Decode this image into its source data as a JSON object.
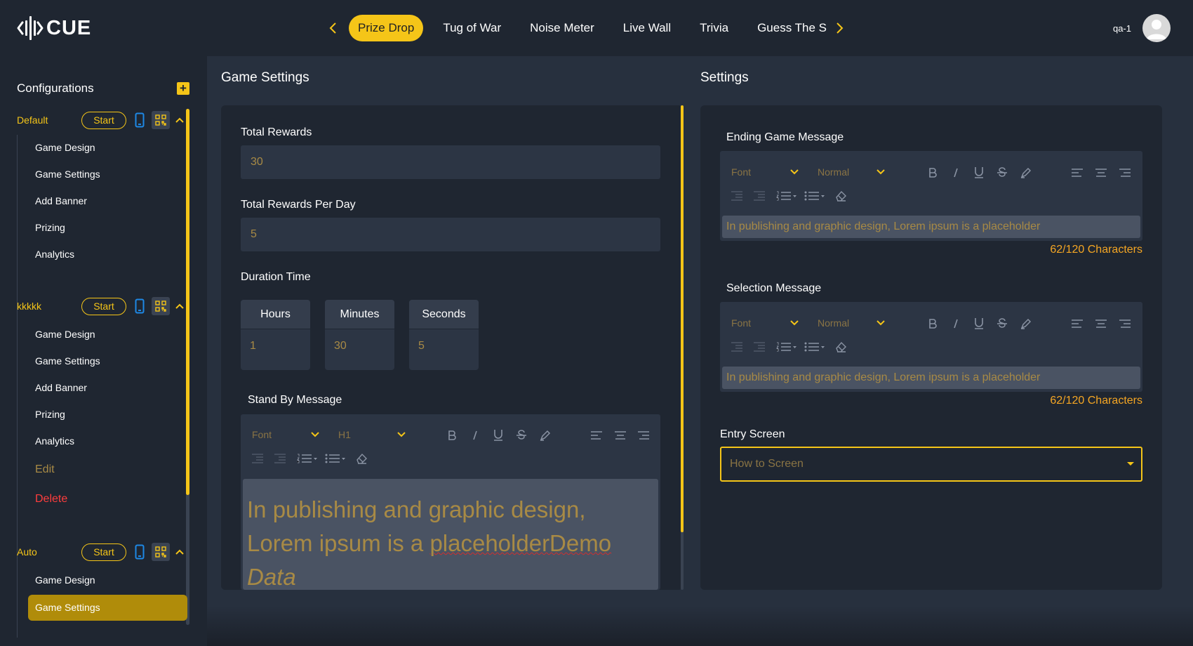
{
  "brand": {
    "name": "CUE"
  },
  "nav": {
    "tabs": [
      {
        "label": "Prize Drop",
        "active": true
      },
      {
        "label": "Tug of War"
      },
      {
        "label": "Noise Meter"
      },
      {
        "label": "Live Wall"
      },
      {
        "label": "Trivia"
      },
      {
        "label": "Guess The Sc"
      }
    ]
  },
  "user": {
    "name": "qa-1"
  },
  "sidebar": {
    "title": "Configurations",
    "groups": [
      {
        "name": "Default",
        "start_label": "Start",
        "items": [
          "Game Design",
          "Game Settings",
          "Add Banner",
          "Prizing",
          "Analytics"
        ]
      },
      {
        "name": "kkkkk",
        "start_label": "Start",
        "items": [
          "Game Design",
          "Game Settings",
          "Add Banner",
          "Prizing",
          "Analytics"
        ],
        "edit_label": "Edit",
        "delete_label": "Delete"
      },
      {
        "name": "Auto",
        "start_label": "Start",
        "items": [
          "Game Design",
          "Game Settings"
        ],
        "active_item": "Game Settings"
      }
    ]
  },
  "game_settings": {
    "title": "Game Settings",
    "total_rewards": {
      "label": "Total Rewards",
      "value": "30"
    },
    "total_rewards_per_day": {
      "label": "Total Rewards Per Day",
      "value": "5"
    },
    "duration": {
      "label": "Duration Time",
      "hours": {
        "label": "Hours",
        "value": "1"
      },
      "minutes": {
        "label": "Minutes",
        "value": "30"
      },
      "seconds": {
        "label": "Seconds",
        "value": "5"
      }
    },
    "standby": {
      "label": "Stand By Message",
      "font": "Font",
      "size": "H1",
      "text_a": "In publishing and graphic design, Lorem ipsum is a ",
      "text_b": "placeholderDemo",
      "text_c": "Data"
    }
  },
  "settings": {
    "title": "Settings",
    "ending": {
      "label": "Ending Game Message",
      "font": "Font",
      "size": "Normal",
      "text": "In publishing and graphic design, Lorem ipsum is a placeholder",
      "counter": "62/120 Characters"
    },
    "selection": {
      "label": "Selection Message",
      "font": "Font",
      "size": "Normal",
      "text": "In publishing and graphic design, Lorem ipsum is a placeholder",
      "counter": "62/120 Characters"
    },
    "entry_screen": {
      "label": "Entry Screen",
      "value": "How to Screen"
    }
  },
  "colors": {
    "accent": "#f5c518",
    "bg": "#1f2631",
    "panel": "#27303e",
    "muted_text": "#a88a45",
    "danger": "#ff3d3d",
    "counter": "#f5a623"
  }
}
